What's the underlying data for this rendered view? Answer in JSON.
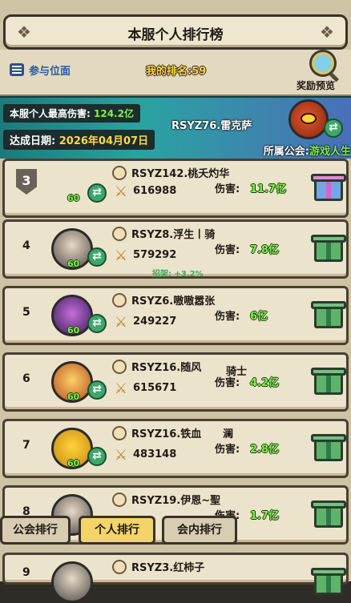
{
  "header": {
    "title": "本服个人排行榜"
  },
  "subbar": {
    "position_label": "参与位面",
    "my_rank": "我的排名:59",
    "reward_label": "奖励预览"
  },
  "top_banner": {
    "max_damage_label": "本服个人最高伤害:",
    "max_damage_value": "124.2亿",
    "date_label": "达成日期:",
    "date_value": "2026年04月07日",
    "top_player": "RSYZ76.雷克萨",
    "guild_label": "所属公会:",
    "guild_value": "游戏人生"
  },
  "damage_label": "伤害:",
  "rows": [
    {
      "rank": "3",
      "name": "RSYZ142.桃夭灼华",
      "level": "60",
      "power": "616988",
      "damage": "11.7亿",
      "extra": ""
    },
    {
      "rank": "4",
      "name": "RSYZ8.浮生丨骑",
      "level": "60",
      "power": "579292",
      "damage": "7.8亿",
      "extra": "招架: +3.2%"
    },
    {
      "rank": "5",
      "name": "RSYZ6.嗷嗷嚣张",
      "level": "60",
      "power": "249227",
      "damage": "6亿",
      "extra": ""
    },
    {
      "rank": "6",
      "name": "RSYZ16.随风",
      "level": "60",
      "power": "615671",
      "damage": "4.2亿",
      "extra": ""
    },
    {
      "rank": "7",
      "name": "RSYZ16.铁血",
      "level": "60",
      "power": "483148",
      "damage": "2.8亿",
      "extra": ""
    },
    {
      "rank": "8",
      "name": "RSYZ19.伊恩~聖",
      "level": "60",
      "power": "",
      "damage": "1.7亿",
      "extra": ""
    },
    {
      "rank": "9",
      "name": "RSYZ3.红柿子",
      "level": "",
      "power": "",
      "damage": "",
      "extra": ""
    }
  ],
  "row_suffix": {
    "6": "骑士",
    "7": "澜"
  },
  "tabs": [
    {
      "label": "公会排行"
    },
    {
      "label": "个人排行"
    },
    {
      "label": "会内排行"
    }
  ],
  "colors": {
    "accent_green": "#7ef24a",
    "accent_gold": "#ffd84a",
    "active_tab": "#f3d46a"
  }
}
